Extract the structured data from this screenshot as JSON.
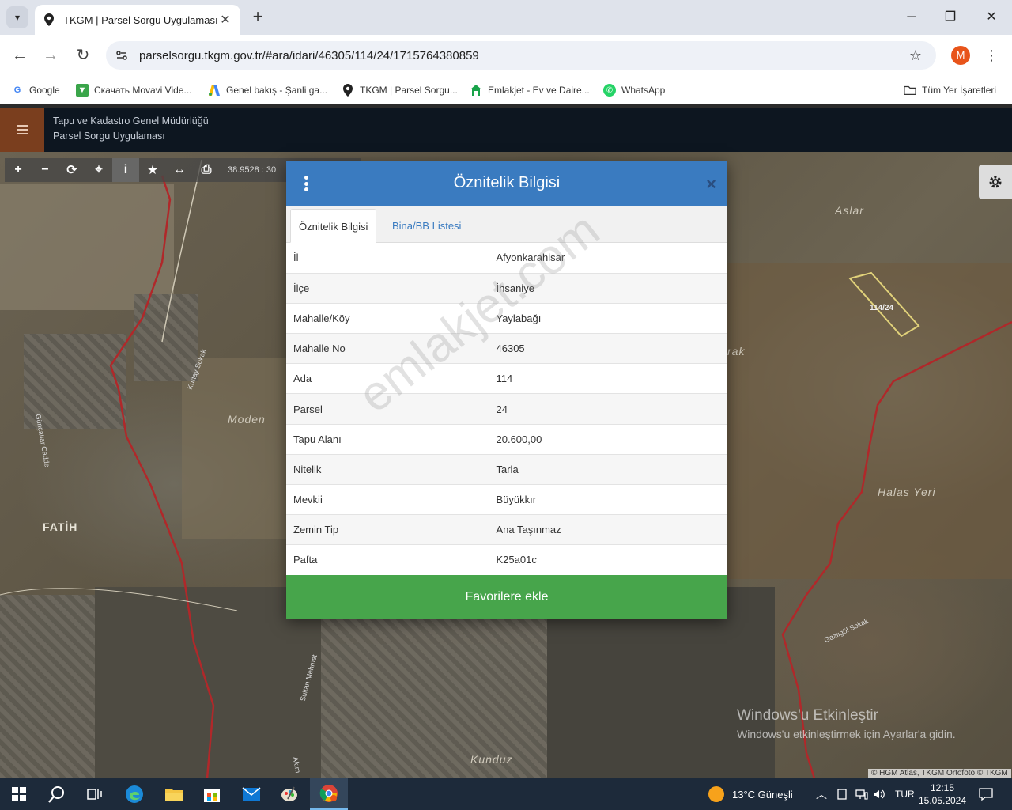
{
  "browser": {
    "tab_title": "TKGM | Parsel Sorgu Uygulaması",
    "tab_close": "✕",
    "new_tab": "+",
    "url": "parselsorgu.tkgm.gov.tr/#ara/idari/46305/114/24/1715764380859",
    "avatar_letter": "M",
    "bookmarks": [
      {
        "label": "Google",
        "icon": "google-icon"
      },
      {
        "label": "Скачать Movavi Vide...",
        "icon": "movavi-icon"
      },
      {
        "label": "Genel bakış - Şanli ga...",
        "icon": "google-ads-icon"
      },
      {
        "label": "TKGM | Parsel Sorgu...",
        "icon": "map-pin-icon"
      },
      {
        "label": "Emlakjet - Ev ve Daire...",
        "icon": "house-icon"
      },
      {
        "label": "WhatsApp",
        "icon": "whatsapp-icon"
      }
    ],
    "all_bookmarks": "Tüm Yer İşaretleri"
  },
  "app": {
    "title_line1": "Tapu ve Kadastro Genel Müdürlüğü",
    "title_line2": "Parsel Sorgu Uygulaması",
    "coordinate_text": "38.9528 : 30"
  },
  "map": {
    "labels": {
      "moden": "Moden",
      "fatih": "FATİH",
      "aslar": "Aslar",
      "halas": "Halas Yeri",
      "kunduz": "Kunduz",
      "rak": "rak",
      "parcel": "114/24"
    },
    "roads": [
      "Kurtay Sokak",
      "Günçatlar Cadde",
      "Sultan Mehmet",
      "Gazlıgöl Sokak",
      "Akım"
    ],
    "attribution": "© HGM Atlas, TKGM Ortofoto © TKGM"
  },
  "modal": {
    "title": "Öznitelik Bilgisi",
    "close": "×",
    "tabs": [
      "Öznitelik Bilgisi",
      "Bina/BB Listesi"
    ],
    "rows": [
      {
        "key": "İl",
        "value": "Afyonkarahisar"
      },
      {
        "key": "İlçe",
        "value": "İhsaniye"
      },
      {
        "key": "Mahalle/Köy",
        "value": "Yaylabağı"
      },
      {
        "key": "Mahalle No",
        "value": "46305"
      },
      {
        "key": "Ada",
        "value": "114"
      },
      {
        "key": "Parsel",
        "value": "24"
      },
      {
        "key": "Tapu Alanı",
        "value": "20.600,00"
      },
      {
        "key": "Nitelik",
        "value": "Tarla"
      },
      {
        "key": "Mevkii",
        "value": "Büyükkır"
      },
      {
        "key": "Zemin Tip",
        "value": "Ana Taşınmaz"
      },
      {
        "key": "Pafta",
        "value": "K25a01c"
      }
    ],
    "favorite_button": "Favorilere ekle",
    "watermark": "emlakjet.com"
  },
  "windows": {
    "activate_title": "Windows'u Etkinleştir",
    "activate_sub": "Windows'u etkinleştirmek için Ayarlar'a gidin.",
    "weather": "13°C  Güneşli",
    "lang": "TUR",
    "time": "12:15",
    "date": "15.05.2024"
  },
  "colors": {
    "modal_header": "#3a7bc0",
    "favorite_button": "#47a54b",
    "app_header": "#0d1620",
    "hamburger_bg": "#7a3e1e",
    "boundary_line": "#b0282a"
  }
}
